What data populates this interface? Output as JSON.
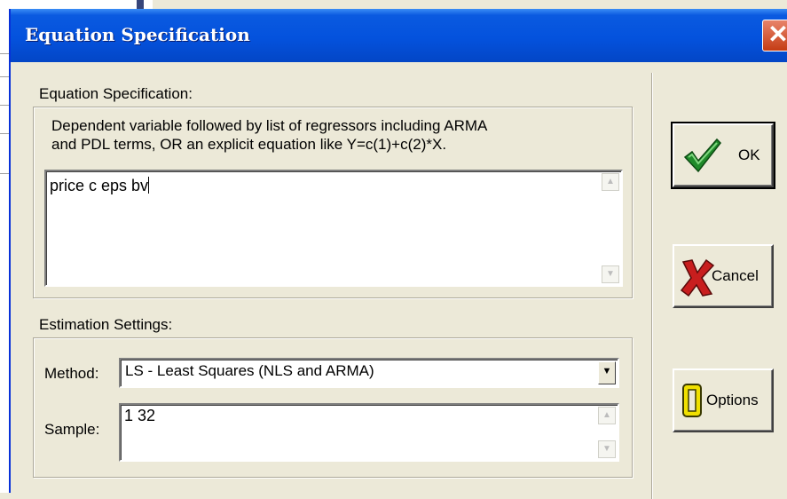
{
  "dialog": {
    "title": "Equation Specification",
    "close_glyph": "✕"
  },
  "equation": {
    "group_label": "Equation Specification:",
    "description_line1": "Dependent variable followed by list of regressors including ARMA",
    "description_line2": "and PDL terms, OR an explicit equation like Y=c(1)+c(2)*X.",
    "value": "price c eps bv"
  },
  "estimation": {
    "group_label": "Estimation Settings:",
    "method_label": "Method:",
    "method_value": "LS  -  Least Squares (NLS and ARMA)",
    "sample_label": "Sample:",
    "sample_value": "1 32"
  },
  "buttons": {
    "ok": "OK",
    "cancel": "Cancel",
    "options": "Options"
  },
  "icons": {
    "ok": "green-checkmark-icon",
    "cancel": "red-x-icon",
    "options": "yellow-bracket-icon",
    "close": "close-icon"
  },
  "colors": {
    "titlebar": "#0452dd",
    "close": "#c43c14",
    "dialog_bg": "#ece9d8"
  }
}
